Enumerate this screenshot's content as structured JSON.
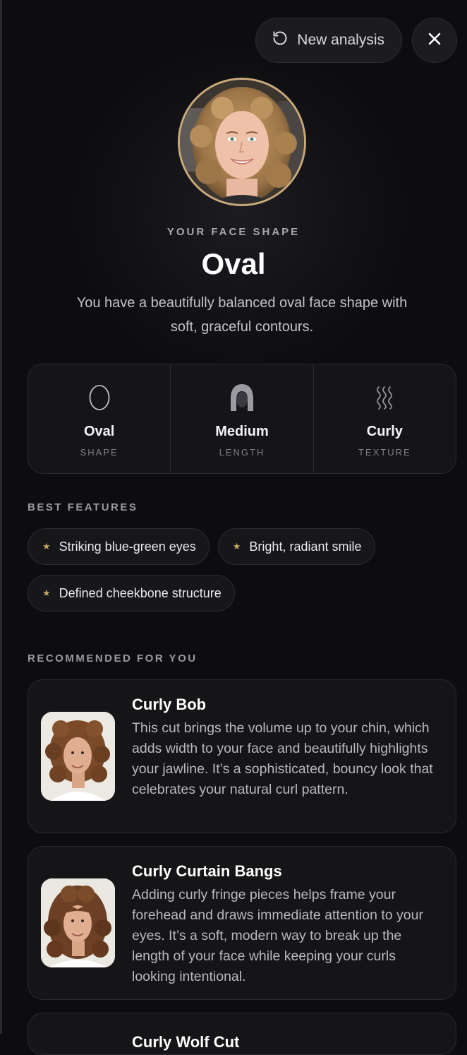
{
  "header": {
    "new_analysis_label": "New analysis",
    "icons": {
      "refresh": "refresh-icon",
      "close": "close-icon"
    }
  },
  "hero": {
    "eyebrow": "YOUR FACE SHAPE",
    "title": "Oval",
    "description": "You have a beautifully balanced oval face shape with soft, graceful contours."
  },
  "stats": [
    {
      "icon": "oval-shape-icon",
      "value": "Oval",
      "label": "SHAPE"
    },
    {
      "icon": "hair-length-icon",
      "value": "Medium",
      "label": "LENGTH"
    },
    {
      "icon": "wavy-texture-icon",
      "value": "Curly",
      "label": "TEXTURE"
    }
  ],
  "best_features": {
    "label": "BEST FEATURES",
    "items": [
      "Striking blue-green eyes",
      "Bright, radiant smile",
      "Defined cheekbone structure"
    ]
  },
  "recommendations": {
    "label": "RECOMMENDED FOR YOU",
    "items": [
      {
        "title": "Curly Bob",
        "text": "This cut brings the volume up to your chin, which adds width to your face and beautifully highlights your jawline. It’s a sophisticated, bouncy look that celebrates your natural curl pattern."
      },
      {
        "title": "Curly Curtain Bangs",
        "text": "Adding curly fringe pieces helps frame your forehead and draws immediate attention to your eyes. It’s a soft, modern way to break up the length of your face while keeping your curls looking intentional."
      },
      {
        "title": "Curly Wolf Cut",
        "text": ""
      }
    ]
  },
  "colors": {
    "accent": "#c9a97a",
    "star": "#c9a45f",
    "background": "#0d0d0f",
    "card": "#151518"
  }
}
